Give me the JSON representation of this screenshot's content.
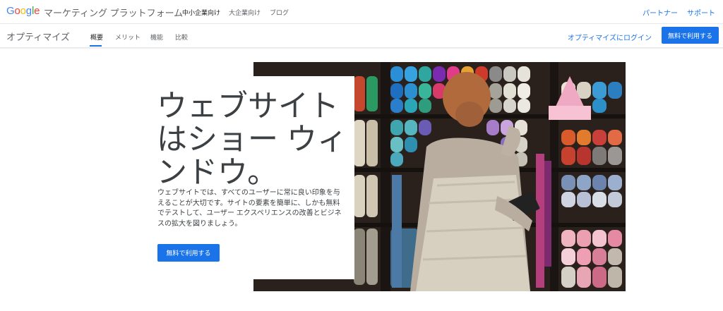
{
  "header": {
    "logo": [
      "G",
      "o",
      "o",
      "g",
      "l",
      "e"
    ],
    "platform": "マーケティング プラットフォーム",
    "nav": [
      "中小企業向け",
      "大企業向け",
      "ブログ"
    ],
    "right_links": [
      "パートナー",
      "サポート"
    ]
  },
  "product": {
    "name": "オプティマイズ",
    "tabs": [
      "概要",
      "メリット",
      "機能",
      "比較"
    ],
    "login": "オプティマイズにログイン",
    "cta": "無料で利用する"
  },
  "hero": {
    "headline": "ウェブサイトはショー ウィンドウ。",
    "description": "ウェブサイトでは、すべてのユーザーに常に良い印象を与えることが大切です。サイトの要素を簡単に、しかも無料でテストして、ユーザー エクスペリエンスの改善とビジネスの拡大を図りましょう。",
    "cta": "無料で利用する",
    "image": "yarn-shop-photo"
  },
  "colors": {
    "accent": "#1a73e8",
    "text": "#3c4043"
  }
}
